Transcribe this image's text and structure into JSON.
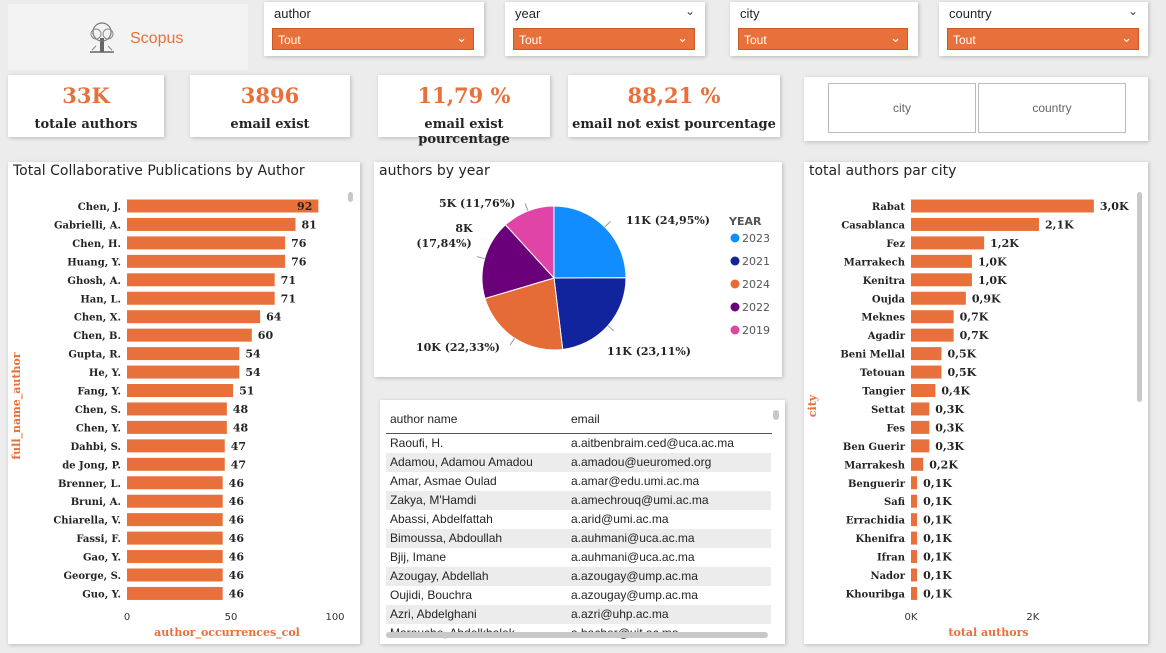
{
  "brand": {
    "name": "Scopus"
  },
  "slicers": [
    {
      "title": "author",
      "value": "Tout"
    },
    {
      "title": "year",
      "value": "Tout"
    },
    {
      "title": "city",
      "value": "Tout"
    },
    {
      "title": "country",
      "value": "Tout"
    }
  ],
  "kpis": [
    {
      "value": "33K",
      "label": "totale authors"
    },
    {
      "value": "3896",
      "label": "email exist"
    },
    {
      "value": "11,79 %",
      "label": "email exist pourcentage"
    },
    {
      "value": "88,21 %",
      "label": "email not exist pourcentage"
    }
  ],
  "buttons": {
    "city": "city",
    "country": "country"
  },
  "chart_data": [
    {
      "type": "bar",
      "orientation": "horizontal",
      "title": "Total Collaborative Publications by Author",
      "xlabel": "author_occurrences_col",
      "ylabel": "full_name_author",
      "xlim": [
        0,
        100
      ],
      "xticks": [
        "0",
        "50",
        "100"
      ],
      "bar_color": "#e8703a",
      "categories": [
        "Chen, J.",
        "Gabrielli, A.",
        "Chen, H.",
        "Huang, Y.",
        "Ghosh, A.",
        "Han, L.",
        "Chen, X.",
        "Chen, B.",
        "Gupta, R.",
        "He, Y.",
        "Fang, Y.",
        "Chen, S.",
        "Chen, Y.",
        "Dahbi, S.",
        "de Jong, P.",
        "Brenner, L.",
        "Bruni, A.",
        "Chiarella, V.",
        "Fassi, F.",
        "Gao, Y.",
        "George, S.",
        "Guo, Y."
      ],
      "values": [
        92,
        81,
        76,
        76,
        71,
        71,
        64,
        60,
        54,
        54,
        51,
        48,
        48,
        47,
        47,
        46,
        46,
        46,
        46,
        46,
        46,
        46
      ],
      "labels": [
        "92",
        "81",
        "76",
        "76",
        "71",
        "71",
        "64",
        "60",
        "54",
        "54",
        "51",
        "48",
        "48",
        "47",
        "47",
        "46",
        "46",
        "46",
        "46",
        "46",
        "46",
        "46"
      ]
    },
    {
      "type": "pie",
      "title": "authors by year",
      "legend_title": "YEAR",
      "legend_position": "right",
      "slices": [
        {
          "name": "2023",
          "value": 24.95,
          "label": "11K (24,95%)",
          "color": "#118dff"
        },
        {
          "name": "2021",
          "value": 23.11,
          "label": "11K (23,11%)",
          "color": "#12239e"
        },
        {
          "name": "2024",
          "value": 22.33,
          "label": "10K (22,33%)",
          "color": "#e66c37"
        },
        {
          "name": "2022",
          "value": 17.84,
          "label_line1": "8K",
          "label_line2": "(17,84%)",
          "color": "#6b007b"
        },
        {
          "name": "2019",
          "value": 11.76,
          "label": "5K (11,76%)",
          "color": "#e044a7"
        }
      ]
    },
    {
      "type": "bar",
      "orientation": "horizontal",
      "title": "total authors par city",
      "xlabel": "total authors",
      "ylabel": "city",
      "xlim": [
        0,
        3200
      ],
      "xticks": [
        "0K",
        "2K"
      ],
      "bar_color": "#e8703a",
      "categories": [
        "Rabat",
        "Casablanca",
        "Fez",
        "Marrakech",
        "Kenitra",
        "Oujda",
        "Meknes",
        "Agadir",
        "Beni Mellal",
        "Tetouan",
        "Tangier",
        "Settat",
        "Fes",
        "Ben Guerir",
        "Marrakesh",
        "Benguerir",
        "Safi",
        "Errachidia",
        "Khenifra",
        "Ifran",
        "Nador",
        "Khouribga"
      ],
      "values": [
        3000,
        2100,
        1200,
        1000,
        1000,
        900,
        700,
        700,
        500,
        500,
        400,
        300,
        300,
        300,
        200,
        100,
        100,
        100,
        100,
        100,
        100,
        100
      ],
      "labels": [
        "3,0K",
        "2,1K",
        "1,2K",
        "1,0K",
        "1,0K",
        "0,9K",
        "0,7K",
        "0,7K",
        "0,5K",
        "0,5K",
        "0,4K",
        "0,3K",
        "0,3K",
        "0,3K",
        "0,2K",
        "0,1K",
        "0,1K",
        "0,1K",
        "0,1K",
        "0,1K",
        "0,1K",
        "0,1K"
      ]
    }
  ],
  "table": {
    "columns": [
      "author name",
      "email"
    ],
    "rows": [
      [
        "Raoufi, H.",
        "a.aitbenbraim.ced@uca.ac.ma"
      ],
      [
        "Adamou, Adamou Amadou",
        "a.amadou@ueuromed.org"
      ],
      [
        "Amar, Asmae Oulad",
        "a.amar@edu.umi.ac.ma"
      ],
      [
        "Zakya, M'Hamdi",
        "a.amechrouq@umi.ac.ma"
      ],
      [
        "Abassi, Abdelfattah",
        "a.arid@umi.ac.ma"
      ],
      [
        "Bimoussa, Abdoullah",
        "a.auhmani@uca.ac.ma"
      ],
      [
        "Bjij, Imane",
        "a.auhmani@uca.ac.ma"
      ],
      [
        "Azougay, Abdellah",
        "a.azougay@ump.ac.ma"
      ],
      [
        "Oujidi, Bouchra",
        "a.azougay@ump.ac.ma"
      ],
      [
        "Azri, Abdelghani",
        "a.azri@uhp.ac.ma"
      ],
      [
        "Marouche, Abdelkhalek",
        "a.bacher@uit.ac.ma"
      ]
    ]
  }
}
